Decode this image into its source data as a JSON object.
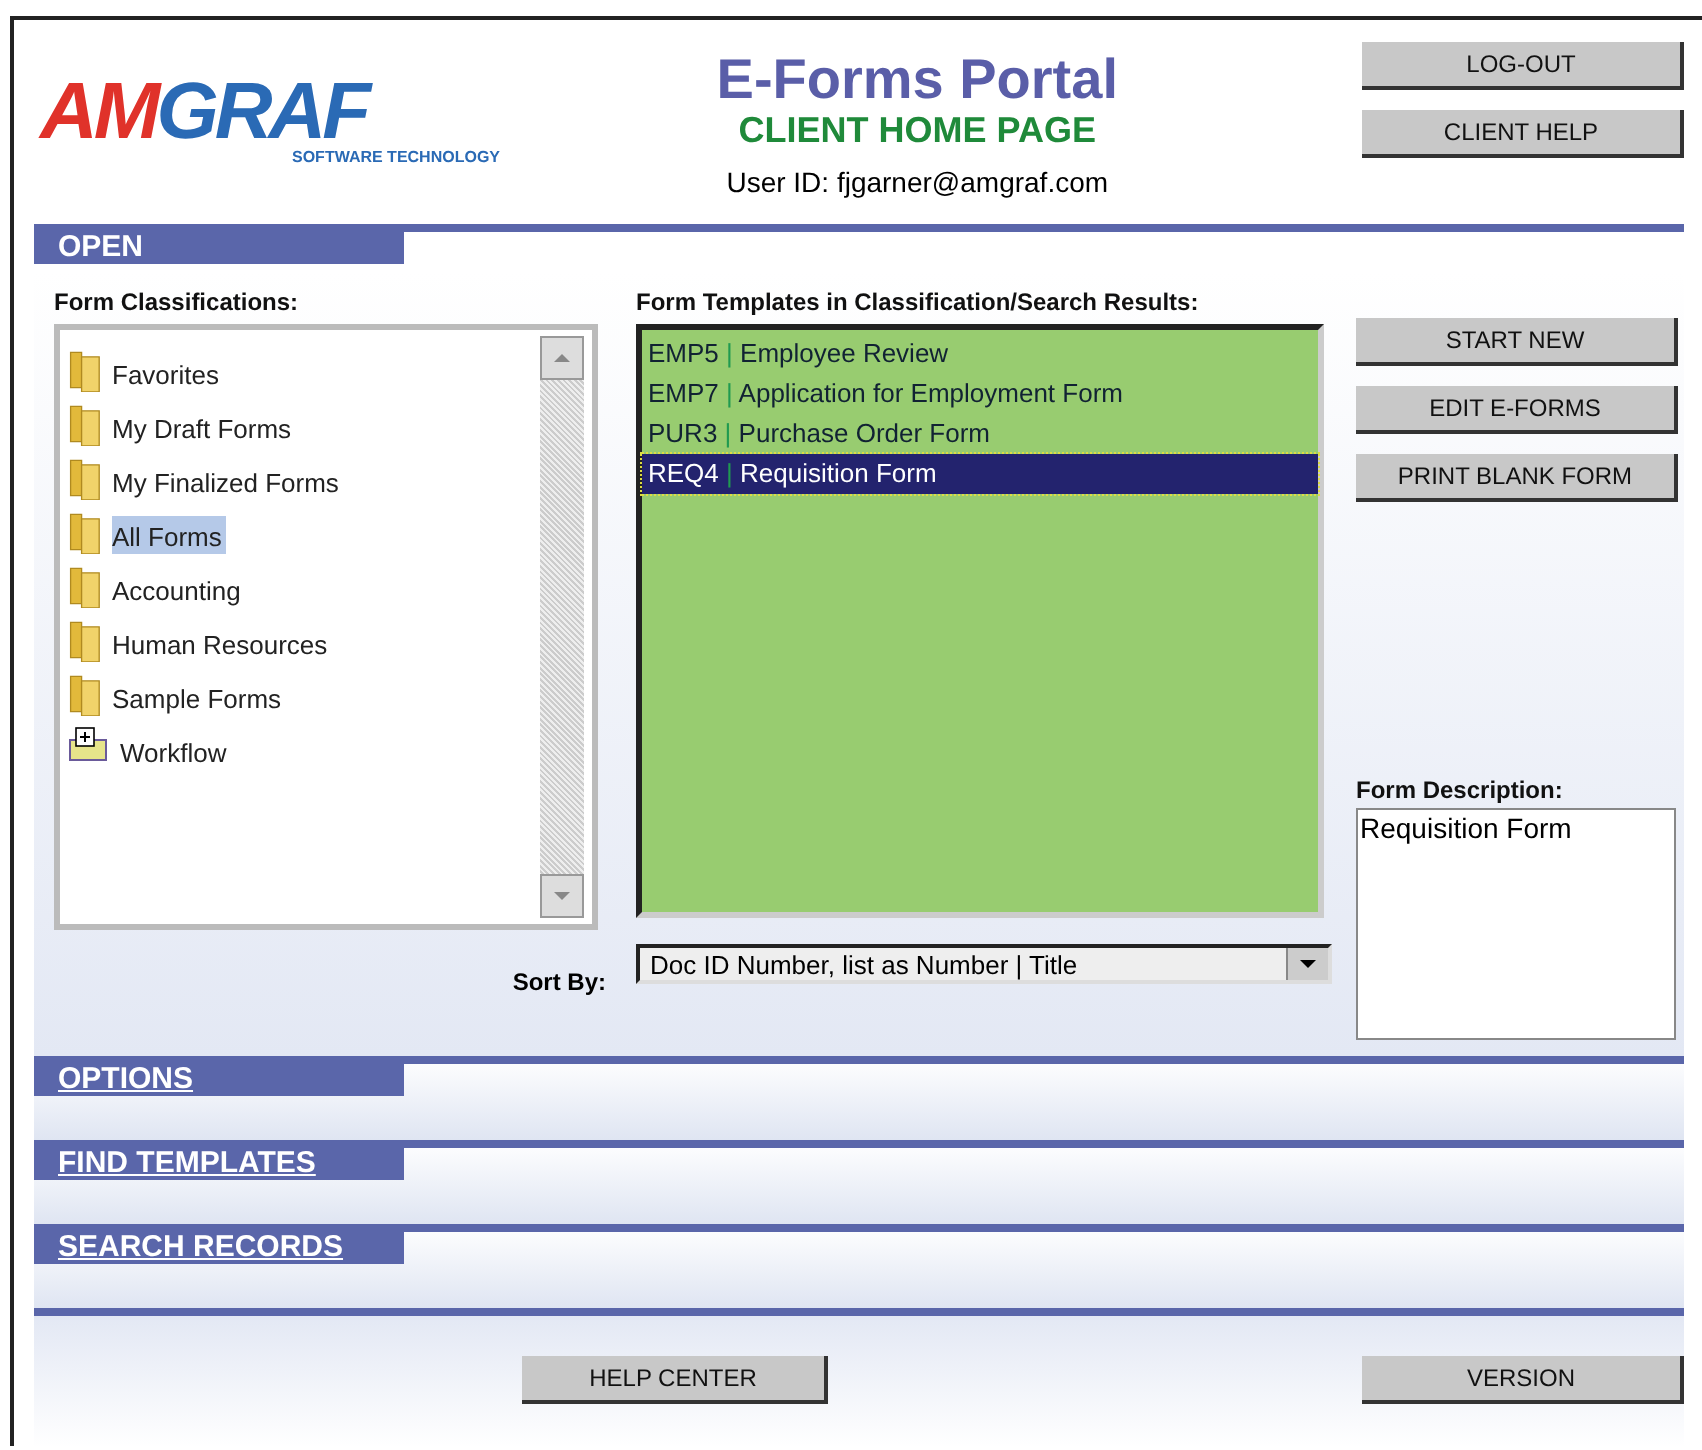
{
  "logo": {
    "mark_left": "AM",
    "mark_right": "GRAF",
    "tagline": "SOFTWARE TECHNOLOGY"
  },
  "header": {
    "title": "E-Forms Portal",
    "subtitle": "CLIENT HOME PAGE",
    "user_id": "User ID: fjgarner@amgraf.com"
  },
  "top_buttons": [
    "LOG-OUT",
    "CLIENT HELP"
  ],
  "open_section": {
    "title": "OPEN",
    "classifications": {
      "label": "Form Classifications:",
      "items": [
        {
          "kind": "folder",
          "label": "Favorites",
          "selected": false
        },
        {
          "kind": "folder",
          "label": "My Draft Forms",
          "selected": false
        },
        {
          "kind": "folder",
          "label": "My Finalized Forms",
          "selected": false
        },
        {
          "kind": "folder",
          "label": "All Forms",
          "selected": true
        },
        {
          "kind": "folder",
          "label": "Accounting",
          "selected": false
        },
        {
          "kind": "folder",
          "label": "Human Resources",
          "selected": false
        },
        {
          "kind": "folder",
          "label": "Sample Forms",
          "selected": false
        },
        {
          "kind": "workflow",
          "label": "Workflow",
          "selected": false
        }
      ]
    },
    "templates": {
      "label": "Form Templates in Classification/Search Results:",
      "items": [
        {
          "code": "EMP5",
          "separator": "|",
          "title": "Employee Review",
          "selected": false
        },
        {
          "code": "EMP7",
          "separator": "|",
          "title": "Application for Employment Form",
          "selected": false
        },
        {
          "code": "PUR3",
          "separator": "|",
          "title": "Purchase Order Form",
          "selected": false
        },
        {
          "code": "REQ4",
          "separator": "|",
          "title": "Requisition Form",
          "selected": true
        }
      ]
    },
    "sort": {
      "label": "Sort By:",
      "value": "Doc ID Number, list as Number | Title"
    },
    "action_buttons": [
      "START NEW",
      "EDIT E-FORMS",
      "PRINT BLANK FORM"
    ],
    "description": {
      "label": "Form Description:",
      "value": "Requisition Form"
    }
  },
  "collapsed_sections": [
    "OPTIONS",
    "FIND TEMPLATES",
    "SEARCH RECORDS"
  ],
  "footer_buttons": [
    "HELP CENTER",
    "VERSION"
  ]
}
